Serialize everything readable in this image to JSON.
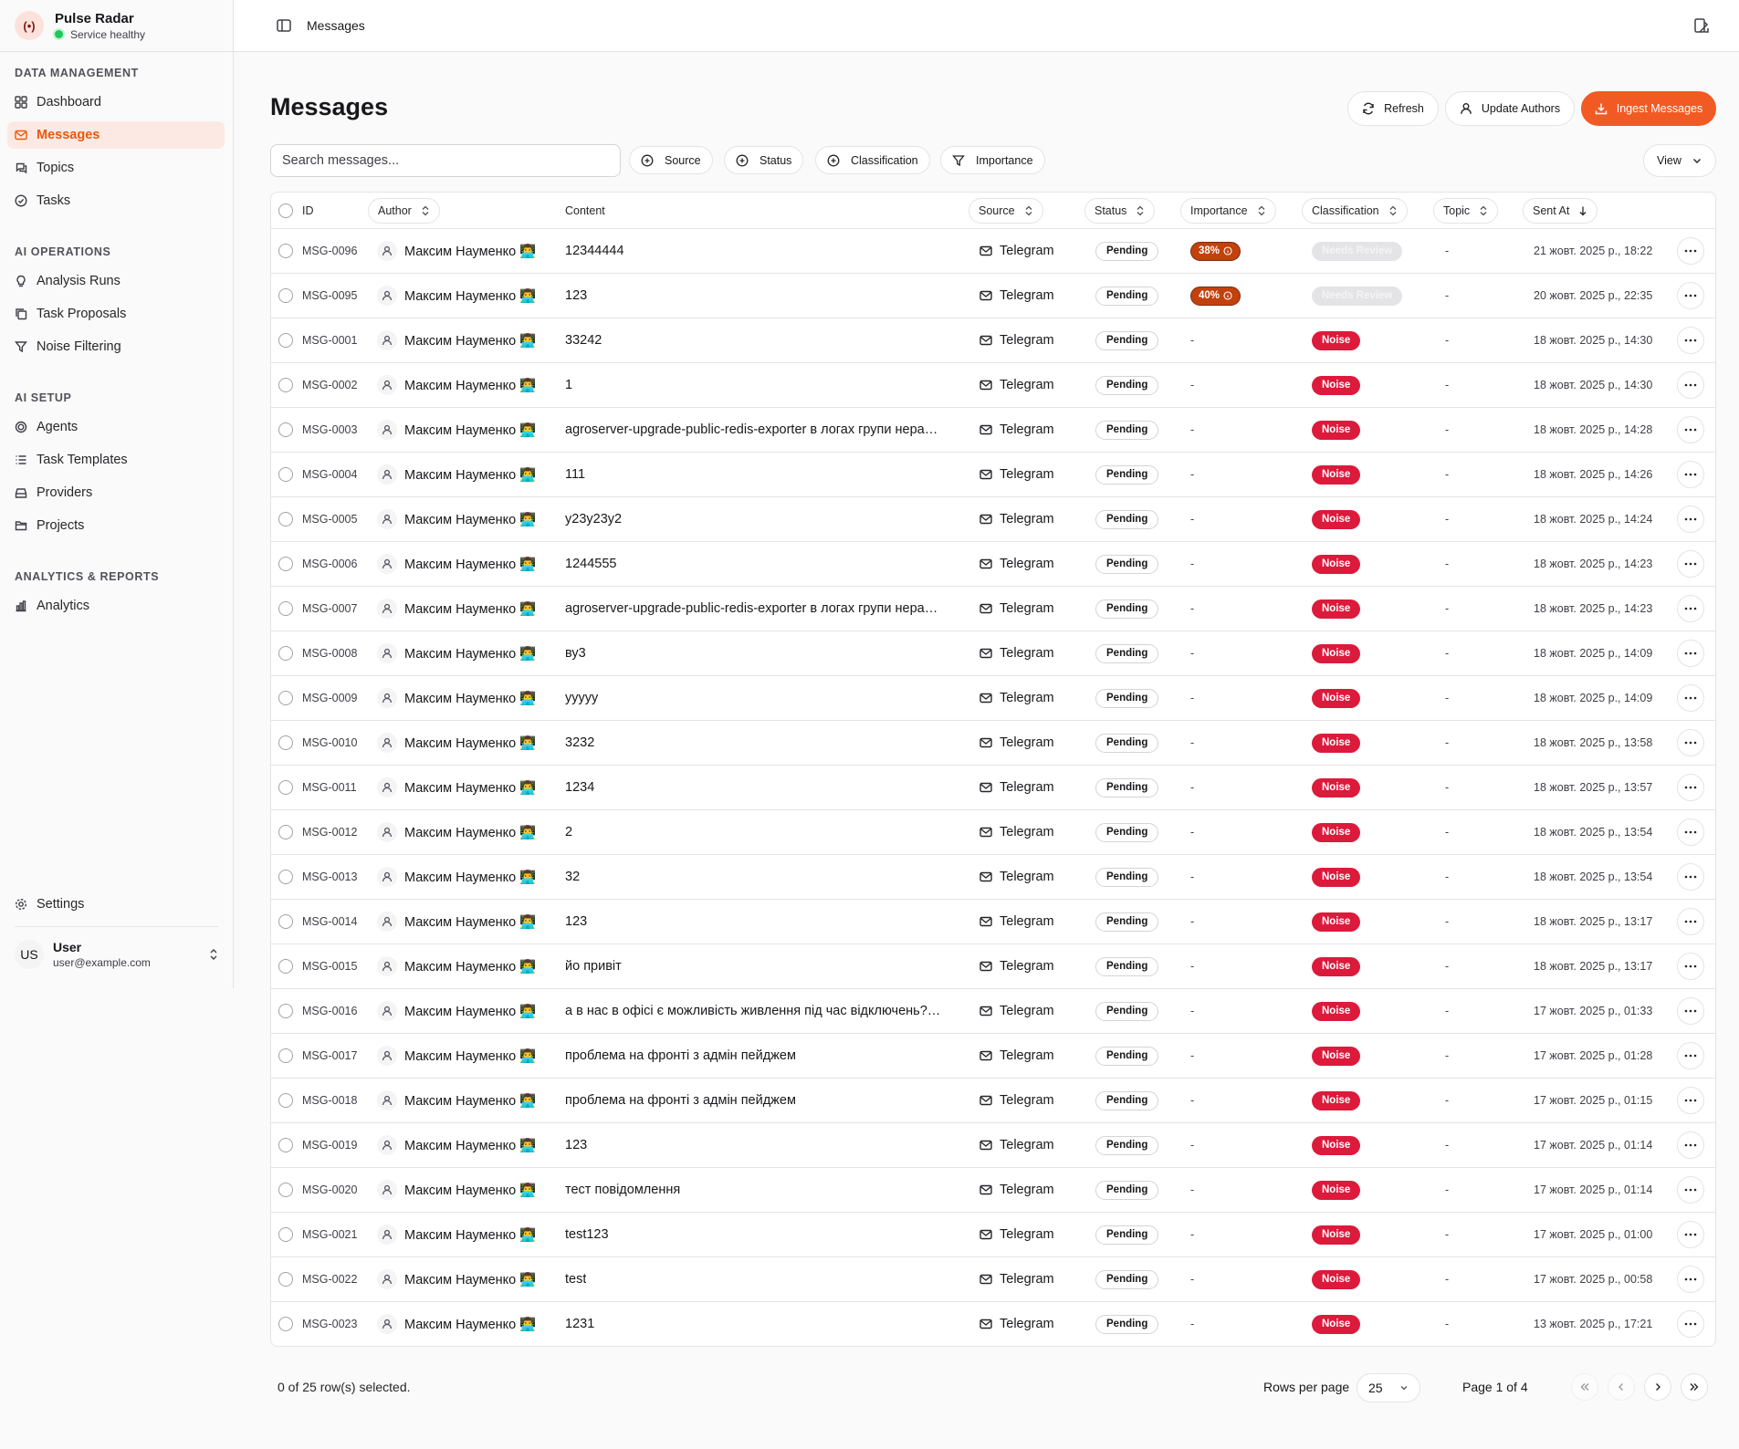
{
  "app": {
    "name": "Pulse Radar",
    "status": "Service healthy",
    "logo_glyph": "(•)"
  },
  "sidebar": {
    "sections": [
      {
        "title": "DATA MANAGEMENT",
        "items": [
          {
            "label": "Dashboard",
            "icon": "grid-icon",
            "active": false
          },
          {
            "label": "Messages",
            "icon": "mail-icon",
            "active": true
          },
          {
            "label": "Topics",
            "icon": "chat-icon",
            "active": false
          },
          {
            "label": "Tasks",
            "icon": "check-circle-icon",
            "active": false
          }
        ]
      },
      {
        "title": "AI OPERATIONS",
        "items": [
          {
            "label": "Analysis Runs",
            "icon": "lightbulb-icon"
          },
          {
            "label": "Task Proposals",
            "icon": "copy-icon"
          },
          {
            "label": "Noise Filtering",
            "icon": "filter-icon"
          }
        ]
      },
      {
        "title": "AI SETUP",
        "items": [
          {
            "label": "Agents",
            "icon": "cpu-icon"
          },
          {
            "label": "Task Templates",
            "icon": "list-icon"
          },
          {
            "label": "Providers",
            "icon": "drive-icon"
          },
          {
            "label": "Projects",
            "icon": "folder-icon"
          }
        ]
      },
      {
        "title": "ANALYTICS & REPORTS",
        "items": [
          {
            "label": "Analytics",
            "icon": "bar-chart-icon"
          }
        ]
      }
    ],
    "settings_label": "Settings",
    "user": {
      "initials": "US",
      "name": "User",
      "email": "user@example.com"
    }
  },
  "header": {
    "breadcrumb": "Messages"
  },
  "page": {
    "title": "Messages",
    "actions": {
      "refresh": "Refresh",
      "update_authors": "Update Authors",
      "ingest": "Ingest Messages"
    },
    "search_placeholder": "Search messages...",
    "filters": [
      "Source",
      "Status",
      "Classification",
      "Importance"
    ],
    "view_label": "View",
    "accent": "#f25a24"
  },
  "table": {
    "columns": {
      "id": "ID",
      "author": "Author",
      "content": "Content",
      "source": "Source",
      "status": "Status",
      "importance": "Importance",
      "classification": "Classification",
      "topic": "Topic",
      "sent_at": "Sent At"
    },
    "rows": [
      {
        "id": "MSG-0096",
        "author": "Максим Науменко 👨‍💻",
        "content": "12344444",
        "source": "Telegram",
        "status": "Pending",
        "importance": "38%",
        "classification": "Needs Review",
        "topic": "-",
        "sent": "21 жовт. 2025 р., 18:22"
      },
      {
        "id": "MSG-0095",
        "author": "Максим Науменко 👨‍💻",
        "content": "123",
        "source": "Telegram",
        "status": "Pending",
        "importance": "40%",
        "classification": "Needs Review",
        "topic": "-",
        "sent": "20 жовт. 2025 р., 22:35"
      },
      {
        "id": "MSG-0001",
        "author": "Максим Науменко 👨‍💻",
        "content": "33242",
        "source": "Telegram",
        "status": "Pending",
        "importance": "-",
        "classification": "Noise",
        "topic": "-",
        "sent": "18 жовт. 2025 р., 14:30"
      },
      {
        "id": "MSG-0002",
        "author": "Максим Науменко 👨‍💻",
        "content": "1",
        "source": "Telegram",
        "status": "Pending",
        "importance": "-",
        "classification": "Noise",
        "topic": "-",
        "sent": "18 жовт. 2025 р., 14:30"
      },
      {
        "id": "MSG-0003",
        "author": "Максим Науменко 👨‍💻",
        "content": "agroserver-upgrade-public-redis-exporter в логах групи нера…",
        "source": "Telegram",
        "status": "Pending",
        "importance": "-",
        "classification": "Noise",
        "topic": "-",
        "sent": "18 жовт. 2025 р., 14:28"
      },
      {
        "id": "MSG-0004",
        "author": "Максим Науменко 👨‍💻",
        "content": "111",
        "source": "Telegram",
        "status": "Pending",
        "importance": "-",
        "classification": "Noise",
        "topic": "-",
        "sent": "18 жовт. 2025 р., 14:26"
      },
      {
        "id": "MSG-0005",
        "author": "Максим Науменко 👨‍💻",
        "content": "y23y23y2",
        "source": "Telegram",
        "status": "Pending",
        "importance": "-",
        "classification": "Noise",
        "topic": "-",
        "sent": "18 жовт. 2025 р., 14:24"
      },
      {
        "id": "MSG-0006",
        "author": "Максим Науменко 👨‍💻",
        "content": "1244555",
        "source": "Telegram",
        "status": "Pending",
        "importance": "-",
        "classification": "Noise",
        "topic": "-",
        "sent": "18 жовт. 2025 р., 14:23"
      },
      {
        "id": "MSG-0007",
        "author": "Максим Науменко 👨‍💻",
        "content": "agroserver-upgrade-public-redis-exporter в логах групи нера…",
        "source": "Telegram",
        "status": "Pending",
        "importance": "-",
        "classification": "Noise",
        "topic": "-",
        "sent": "18 жовт. 2025 р., 14:23"
      },
      {
        "id": "MSG-0008",
        "author": "Максим Науменко 👨‍💻",
        "content": "ву3",
        "source": "Telegram",
        "status": "Pending",
        "importance": "-",
        "classification": "Noise",
        "topic": "-",
        "sent": "18 жовт. 2025 р., 14:09"
      },
      {
        "id": "MSG-0009",
        "author": "Максим Науменко 👨‍💻",
        "content": "ууууу",
        "source": "Telegram",
        "status": "Pending",
        "importance": "-",
        "classification": "Noise",
        "topic": "-",
        "sent": "18 жовт. 2025 р., 14:09"
      },
      {
        "id": "MSG-0010",
        "author": "Максим Науменко 👨‍💻",
        "content": "3232",
        "source": "Telegram",
        "status": "Pending",
        "importance": "-",
        "classification": "Noise",
        "topic": "-",
        "sent": "18 жовт. 2025 р., 13:58"
      },
      {
        "id": "MSG-0011",
        "author": "Максим Науменко 👨‍💻",
        "content": "1234",
        "source": "Telegram",
        "status": "Pending",
        "importance": "-",
        "classification": "Noise",
        "topic": "-",
        "sent": "18 жовт. 2025 р., 13:57"
      },
      {
        "id": "MSG-0012",
        "author": "Максим Науменко 👨‍💻",
        "content": "2",
        "source": "Telegram",
        "status": "Pending",
        "importance": "-",
        "classification": "Noise",
        "topic": "-",
        "sent": "18 жовт. 2025 р., 13:54"
      },
      {
        "id": "MSG-0013",
        "author": "Максим Науменко 👨‍💻",
        "content": "32",
        "source": "Telegram",
        "status": "Pending",
        "importance": "-",
        "classification": "Noise",
        "topic": "-",
        "sent": "18 жовт. 2025 р., 13:54"
      },
      {
        "id": "MSG-0014",
        "author": "Максим Науменко 👨‍💻",
        "content": "123",
        "source": "Telegram",
        "status": "Pending",
        "importance": "-",
        "classification": "Noise",
        "topic": "-",
        "sent": "18 жовт. 2025 р., 13:17"
      },
      {
        "id": "MSG-0015",
        "author": "Максим Науменко 👨‍💻",
        "content": "йо привіт",
        "source": "Telegram",
        "status": "Pending",
        "importance": "-",
        "classification": "Noise",
        "topic": "-",
        "sent": "18 жовт. 2025 р., 13:17"
      },
      {
        "id": "MSG-0016",
        "author": "Максим Науменко 👨‍💻",
        "content": "а в нас в офісі є можливість живлення під час відключень?…",
        "source": "Telegram",
        "status": "Pending",
        "importance": "-",
        "classification": "Noise",
        "topic": "-",
        "sent": "17 жовт. 2025 р., 01:33"
      },
      {
        "id": "MSG-0017",
        "author": "Максим Науменко 👨‍💻",
        "content": "проблема на фронті з адмін пейджем",
        "source": "Telegram",
        "status": "Pending",
        "importance": "-",
        "classification": "Noise",
        "topic": "-",
        "sent": "17 жовт. 2025 р., 01:28"
      },
      {
        "id": "MSG-0018",
        "author": "Максим Науменко 👨‍💻",
        "content": "проблема на фронті з адмін пейджем",
        "source": "Telegram",
        "status": "Pending",
        "importance": "-",
        "classification": "Noise",
        "topic": "-",
        "sent": "17 жовт. 2025 р., 01:15"
      },
      {
        "id": "MSG-0019",
        "author": "Максим Науменко 👨‍💻",
        "content": "123",
        "source": "Telegram",
        "status": "Pending",
        "importance": "-",
        "classification": "Noise",
        "topic": "-",
        "sent": "17 жовт. 2025 р., 01:14"
      },
      {
        "id": "MSG-0020",
        "author": "Максим Науменко 👨‍💻",
        "content": "тест повідомлення",
        "source": "Telegram",
        "status": "Pending",
        "importance": "-",
        "classification": "Noise",
        "topic": "-",
        "sent": "17 жовт. 2025 р., 01:14"
      },
      {
        "id": "MSG-0021",
        "author": "Максим Науменко 👨‍💻",
        "content": "test123",
        "source": "Telegram",
        "status": "Pending",
        "importance": "-",
        "classification": "Noise",
        "topic": "-",
        "sent": "17 жовт. 2025 р., 01:00"
      },
      {
        "id": "MSG-0022",
        "author": "Максим Науменко 👨‍💻",
        "content": "test",
        "source": "Telegram",
        "status": "Pending",
        "importance": "-",
        "classification": "Noise",
        "topic": "-",
        "sent": "17 жовт. 2025 р., 00:58"
      },
      {
        "id": "MSG-0023",
        "author": "Максим Науменко 👨‍💻",
        "content": "1231",
        "source": "Telegram",
        "status": "Pending",
        "importance": "-",
        "classification": "Noise",
        "topic": "-",
        "sent": "13 жовт. 2025 р., 17:21"
      }
    ]
  },
  "footer": {
    "selection": "0 of 25 row(s) selected.",
    "rows_per_page_label": "Rows per page",
    "rows_per_page_value": "25",
    "page_info": "Page 1 of 4"
  }
}
